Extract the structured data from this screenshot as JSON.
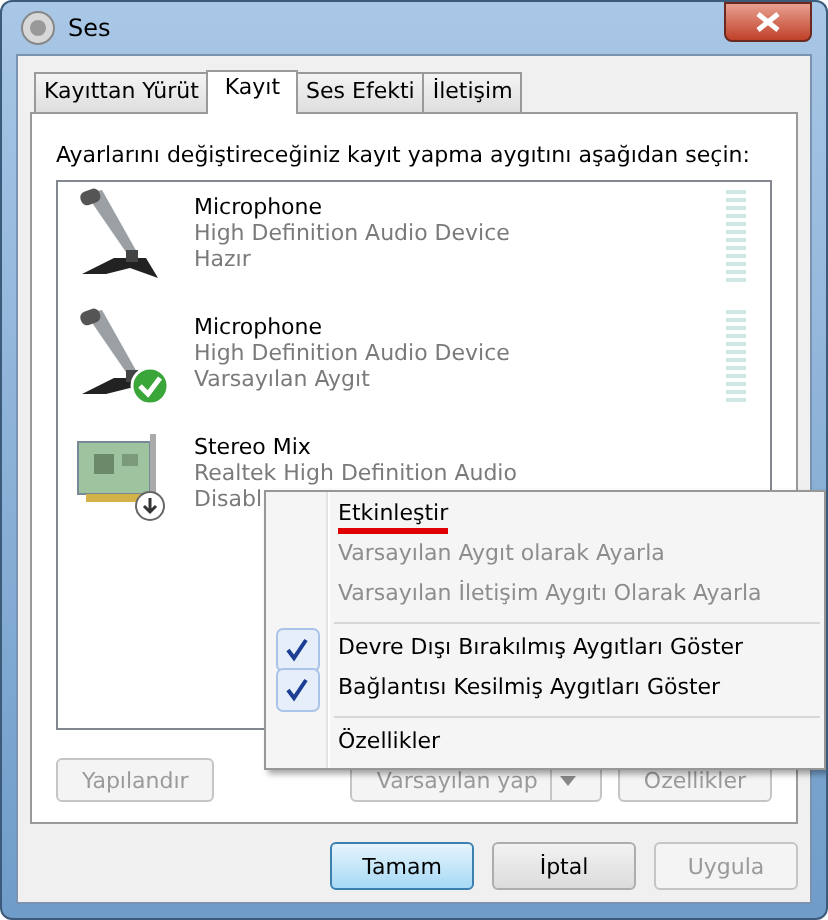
{
  "window": {
    "title": "Ses"
  },
  "tabs": [
    {
      "label": "Kayıttan Yürüt",
      "selected": false
    },
    {
      "label": "Kayıt",
      "selected": true
    },
    {
      "label": "Ses Efekti",
      "selected": false
    },
    {
      "label": "İletişim",
      "selected": false
    }
  ],
  "instruction": "Ayarlarını değiştireceğiniz kayıt yapma aygıtını aşağıdan seçin:",
  "devices": [
    {
      "kind": "microphone",
      "name": "Microphone",
      "driver": "High Definition Audio Device",
      "status": "Hazır",
      "default": false
    },
    {
      "kind": "microphone",
      "name": "Microphone",
      "driver": "High Definition Audio Device",
      "status": "Varsayılan Aygıt",
      "default": true
    },
    {
      "kind": "card",
      "name": "Stereo Mix",
      "driver": "Realtek High Definition Audio",
      "status": "Disabl",
      "disabled": true
    }
  ],
  "panel_buttons": [
    {
      "label": "Yapılandır",
      "disabled": true,
      "split": false
    },
    {
      "label": "Varsayılan yap",
      "disabled": true,
      "split": true
    },
    {
      "label": "Özellikler",
      "disabled": true,
      "split": false
    }
  ],
  "context_menu": [
    {
      "label": "Etkinleştir",
      "disabled": false,
      "checked": false,
      "underlined": true,
      "separator_after": false
    },
    {
      "label": "Varsayılan Aygıt olarak Ayarla",
      "disabled": true,
      "checked": false,
      "underlined": false,
      "separator_after": false
    },
    {
      "label": "Varsayılan İletişim Aygıtı Olarak Ayarla",
      "disabled": true,
      "checked": false,
      "underlined": false,
      "separator_after": true
    },
    {
      "label": "Devre Dışı Bırakılmış Aygıtları Göster",
      "disabled": false,
      "checked": true,
      "underlined": false,
      "separator_after": false
    },
    {
      "label": "Bağlantısı Kesilmiş Aygıtları Göster",
      "disabled": false,
      "checked": true,
      "underlined": false,
      "separator_after": true
    },
    {
      "label": "Özellikler",
      "disabled": false,
      "checked": false,
      "underlined": false,
      "separator_after": false
    }
  ],
  "dialog_buttons": [
    {
      "label": "Tamam",
      "default": true,
      "disabled": false
    },
    {
      "label": "İptal",
      "default": false,
      "disabled": false
    },
    {
      "label": "Uygula",
      "default": false,
      "disabled": true
    }
  ]
}
